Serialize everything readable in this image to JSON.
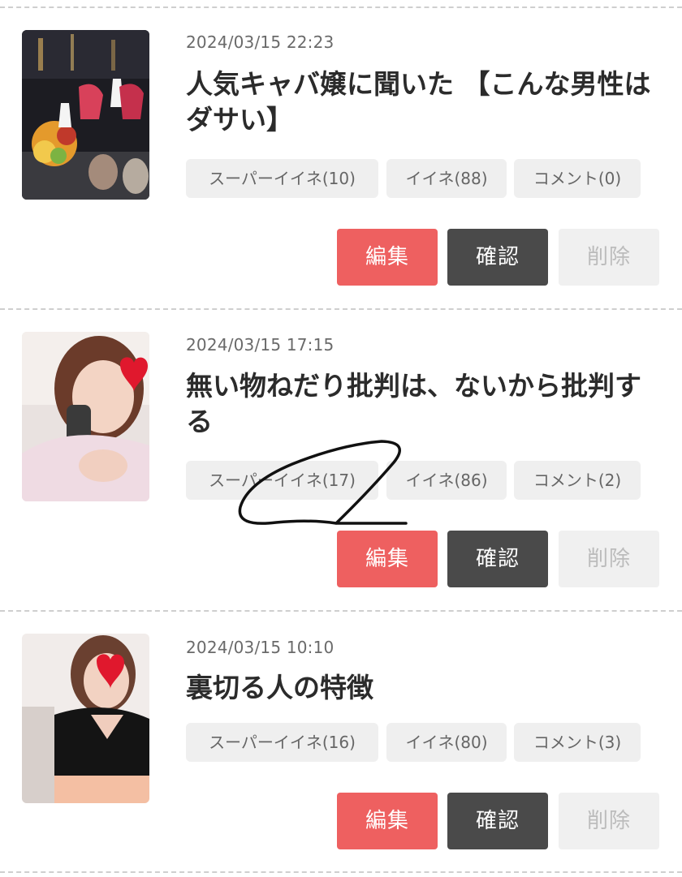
{
  "colors": {
    "edit_button": "#ee6060",
    "confirm_button": "#4a4a4a",
    "delete_button": "#f0f0f0",
    "tag_background": "#efefef",
    "divider": "#cfcfcf"
  },
  "posts": [
    {
      "date": "2024/03/15 22:23",
      "title": "人気キャバ嬢に聞いた 【こんな男性はダサい】",
      "thumbnail_icon": "bar-table-photo",
      "tags": {
        "super_like": "スーパーイイネ(10)",
        "like": "イイネ(88)",
        "comment": "コメント(0)"
      },
      "buttons": {
        "edit": "編集",
        "confirm": "確認",
        "delete": "削除"
      }
    },
    {
      "date": "2024/03/15 17:15",
      "title": "無い物ねだり批判は、ないから批判する",
      "thumbnail_icon": "woman-pink-sweater-heart-photo",
      "tags": {
        "super_like": "スーパーイイネ(17)",
        "like": "イイネ(86)",
        "comment": "コメント(2)"
      },
      "buttons": {
        "edit": "編集",
        "confirm": "確認",
        "delete": "削除"
      }
    },
    {
      "date": "2024/03/15 10:10",
      "title": "裏切る人の特徴",
      "thumbnail_icon": "woman-black-top-heart-photo",
      "tags": {
        "super_like": "スーパーイイネ(16)",
        "like": "イイネ(80)",
        "comment": "コメント(3)"
      },
      "buttons": {
        "edit": "編集",
        "confirm": "確認",
        "delete": "削除"
      }
    }
  ]
}
